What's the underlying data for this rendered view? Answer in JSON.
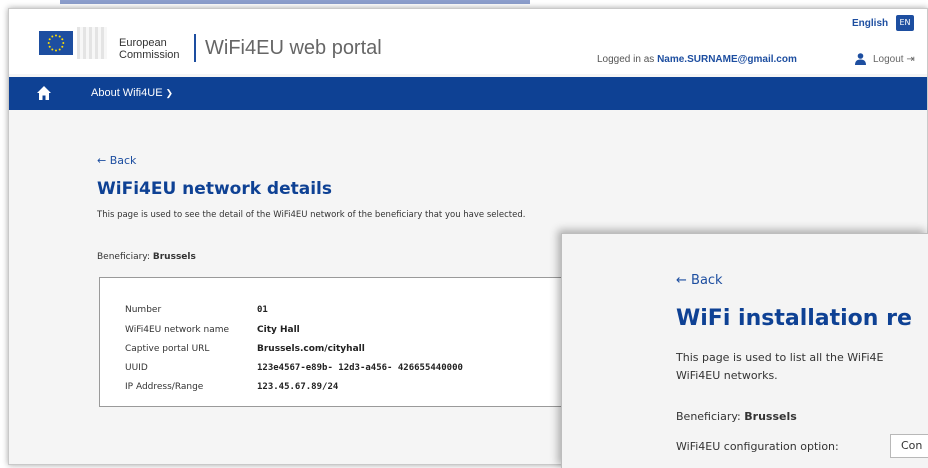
{
  "header": {
    "org_line1": "European",
    "org_line2": "Commission",
    "portal_title": "WiFi4EU web portal",
    "language": "English",
    "language_code": "EN",
    "logged_in_prefix": "Logged in as",
    "user_email": "Name.SURNAME@gmail.com",
    "logout_label": "Logout"
  },
  "nav": {
    "about_label": "About Wifi4UE"
  },
  "details_page": {
    "back_label": "← Back",
    "title": "WiFi4EU network details",
    "description": "This page is used to see the detail of the WiFi4EU network of the beneficiary that you have selected.",
    "beneficiary_label": "Beneficiary:",
    "beneficiary_value": "Brussels",
    "fields": [
      {
        "label": "Number",
        "value": "01"
      },
      {
        "label": "WiFi4EU network name",
        "value": "City Hall"
      },
      {
        "label": "Captive portal URL",
        "value": "Brussels.com/cityhall"
      },
      {
        "label": "UUID",
        "value": "123e4567-e89b- 12d3-a456- 426655440000"
      },
      {
        "label": "IP Address/Range",
        "value": "123.45.67.89/24"
      }
    ]
  },
  "installation_page": {
    "back_label": "← Back",
    "title": "WiFi installation re",
    "description_line1": "This page is used to list all the WiFi4E",
    "description_line2": "WiFi4EU networks.",
    "beneficiary_label": "Beneficiary:",
    "beneficiary_value": "Brussels",
    "config_label": "WiFi4EU configuration option:",
    "config_value": "Con"
  },
  "colors": {
    "brand_blue": "#0e4194",
    "link_blue": "#1d4ea0",
    "background": "#f5f5f5"
  }
}
